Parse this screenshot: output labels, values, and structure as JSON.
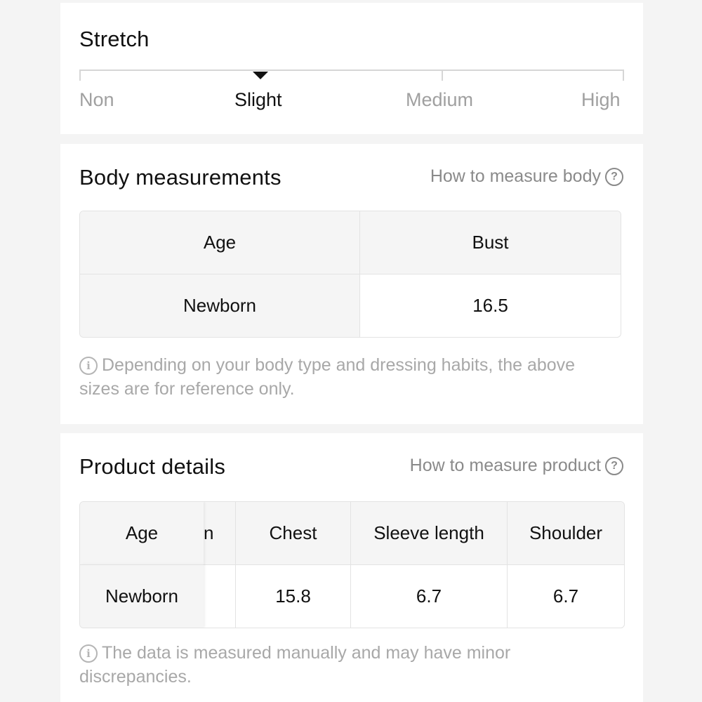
{
  "stretch": {
    "title": "Stretch",
    "levels": [
      "Non",
      "Slight",
      "Medium",
      "High"
    ],
    "selected": "Slight"
  },
  "body_measurements": {
    "title": "Body measurements",
    "help_link": "How to measure body",
    "table": {
      "headers": [
        "Age",
        "Bust"
      ],
      "rows": [
        [
          "Newborn",
          "16.5"
        ]
      ]
    },
    "note": "Depending on your body type and dressing habits, the above sizes are for reference only."
  },
  "product_details": {
    "title": "Product details",
    "help_link": "How to measure product",
    "table": {
      "headers": [
        "Age",
        "n",
        "Chest",
        "Sleeve length",
        "Shoulder"
      ],
      "rows": [
        [
          "Newborn",
          "",
          "15.8",
          "6.7",
          "6.7"
        ]
      ]
    },
    "note": "The data is measured manually and may have minor discrepancies."
  },
  "icons": {
    "help": "question-circle-icon",
    "info": "info-circle-icon"
  }
}
